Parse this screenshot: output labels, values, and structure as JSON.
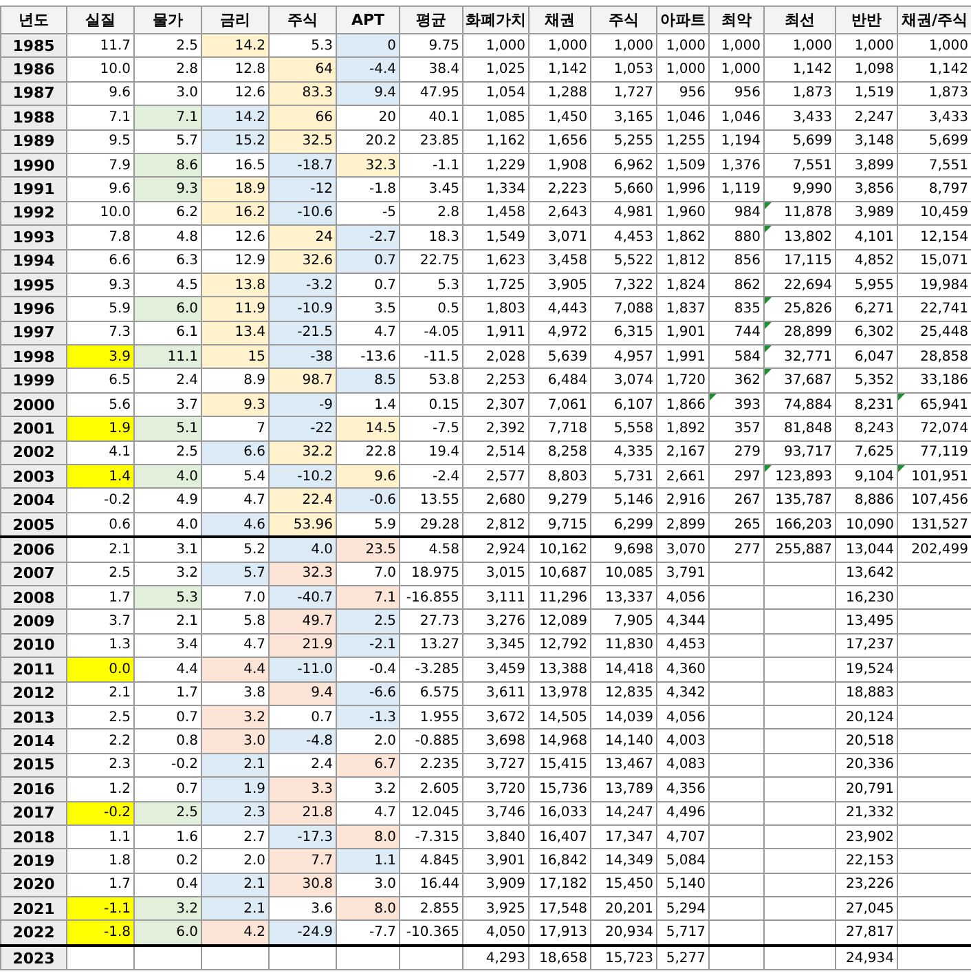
{
  "table": {
    "columns": [
      "년도",
      "실질",
      "물가",
      "금리",
      "주식",
      "APT",
      "평균",
      "화폐가치",
      "채권",
      "주식",
      "아파트",
      "최악",
      "최선",
      "반반",
      "채권/주식"
    ],
    "rows": [
      {
        "group_end": false,
        "cells": [
          "1985",
          "11.7",
          "2.5",
          {
            "text": "14.2",
            "color": "#fff2cc"
          },
          "5.3",
          {
            "text": "0",
            "color": "#ddebf7"
          },
          "9.75",
          "1,000",
          "1,000",
          "1,000",
          "1,000",
          "1,000",
          "1,000",
          "1,000",
          "1,000"
        ]
      },
      {
        "group_end": false,
        "cells": [
          "1986",
          "10.0",
          "2.8",
          "12.8",
          {
            "text": "64",
            "color": "#fff2cc"
          },
          {
            "text": "-4.4",
            "color": "#ddebf7"
          },
          "38.4",
          "1,025",
          "1,142",
          "1,053",
          "1,000",
          "1,000",
          "1,142",
          "1,098",
          "1,142"
        ]
      },
      {
        "group_end": false,
        "cells": [
          "1987",
          "9.6",
          "3.0",
          "12.6",
          {
            "text": "83.3",
            "color": "#fff2cc"
          },
          {
            "text": "9.4",
            "color": "#ddebf7"
          },
          "47.95",
          "1,054",
          "1,288",
          "1,727",
          "956",
          "956",
          "1,873",
          "1,519",
          "1,873"
        ]
      },
      {
        "group_end": false,
        "cells": [
          "1988",
          "7.1",
          {
            "text": "7.1",
            "color": "#e2efda"
          },
          {
            "text": "14.2",
            "color": "#ddebf7"
          },
          {
            "text": "66",
            "color": "#fff2cc"
          },
          "20",
          "40.1",
          "1,085",
          "1,450",
          "3,165",
          "1,046",
          "1,046",
          "3,433",
          "2,247",
          "3,433"
        ]
      },
      {
        "group_end": false,
        "cells": [
          "1989",
          "9.5",
          "5.7",
          {
            "text": "15.2",
            "color": "#ddebf7"
          },
          {
            "text": "32.5",
            "color": "#fff2cc"
          },
          "20.2",
          "23.85",
          "1,162",
          "1,656",
          "5,255",
          "1,255",
          "1,194",
          "5,699",
          "3,148",
          "5,699"
        ]
      },
      {
        "group_end": false,
        "cells": [
          "1990",
          "7.9",
          {
            "text": "8.6",
            "color": "#e2efda"
          },
          "16.5",
          {
            "text": "-18.7",
            "color": "#ddebf7"
          },
          {
            "text": "32.3",
            "color": "#fff2cc"
          },
          "-1.1",
          "1,229",
          "1,908",
          "6,962",
          "1,509",
          "1,376",
          "7,551",
          "3,899",
          "7,551"
        ]
      },
      {
        "group_end": false,
        "cells": [
          "1991",
          "9.6",
          {
            "text": "9.3",
            "color": "#e2efda"
          },
          {
            "text": "18.9",
            "color": "#fff2cc"
          },
          {
            "text": "-12",
            "color": "#ddebf7"
          },
          "-1.8",
          "3.45",
          "1,334",
          "2,223",
          "5,660",
          "1,996",
          "1,119",
          "9,990",
          "3,856",
          "8,797"
        ]
      },
      {
        "group_end": false,
        "cells": [
          "1992",
          "10.0",
          "6.2",
          {
            "text": "16.2",
            "color": "#fff2cc"
          },
          {
            "text": "-10.6",
            "color": "#ddebf7"
          },
          "-5",
          "2.8",
          "1,458",
          "2,643",
          "4,981",
          "1,960",
          "984",
          {
            "text": "11,878",
            "note": true
          },
          "3,989",
          "10,459"
        ]
      },
      {
        "group_end": false,
        "cells": [
          "1993",
          "7.8",
          "4.8",
          "12.6",
          {
            "text": "24",
            "color": "#fff2cc"
          },
          {
            "text": "-2.7",
            "color": "#ddebf7"
          },
          "18.3",
          "1,549",
          "3,071",
          "4,453",
          "1,862",
          "880",
          {
            "text": "13,802",
            "note": true
          },
          "4,101",
          "12,154"
        ]
      },
      {
        "group_end": false,
        "cells": [
          "1994",
          "6.6",
          "6.3",
          "12.9",
          {
            "text": "32.6",
            "color": "#fff2cc"
          },
          {
            "text": "0.7",
            "color": "#ddebf7"
          },
          "22.75",
          "1,623",
          "3,458",
          "5,522",
          "1,812",
          "856",
          "17,115",
          "4,852",
          "15,071"
        ]
      },
      {
        "group_end": false,
        "cells": [
          "1995",
          "9.3",
          "4.5",
          {
            "text": "13.8",
            "color": "#fff2cc"
          },
          {
            "text": "-3.2",
            "color": "#ddebf7"
          },
          "0.7",
          "5.3",
          "1,725",
          "3,905",
          "7,322",
          "1,824",
          "862",
          "22,694",
          "5,955",
          "19,984"
        ]
      },
      {
        "group_end": false,
        "cells": [
          "1996",
          "5.9",
          {
            "text": "6.0",
            "color": "#e2efda"
          },
          {
            "text": "11.9",
            "color": "#fff2cc"
          },
          {
            "text": "-10.9",
            "color": "#ddebf7"
          },
          "3.5",
          "0.5",
          "1,803",
          "4,443",
          "7,088",
          "1,837",
          "835",
          {
            "text": "25,826",
            "note": true
          },
          "6,271",
          "22,741"
        ]
      },
      {
        "group_end": false,
        "cells": [
          "1997",
          "7.3",
          "6.1",
          {
            "text": "13.4",
            "color": "#fff2cc"
          },
          {
            "text": "-21.5",
            "color": "#ddebf7"
          },
          "4.7",
          "-4.05",
          "1,911",
          "4,972",
          "6,315",
          "1,901",
          "744",
          {
            "text": "28,899",
            "note": true
          },
          "6,302",
          "25,448"
        ]
      },
      {
        "group_end": false,
        "cells": [
          "1998",
          {
            "text": "3.9",
            "color": "#ffff00"
          },
          {
            "text": "11.1",
            "color": "#e2efda"
          },
          {
            "text": "15",
            "color": "#fff2cc"
          },
          {
            "text": "-38",
            "color": "#ddebf7"
          },
          "-13.6",
          "-11.5",
          "2,028",
          "5,639",
          "4,957",
          "1,991",
          "584",
          {
            "text": "32,771",
            "note": true
          },
          "6,047",
          "28,858"
        ]
      },
      {
        "group_end": false,
        "cells": [
          "1999",
          "6.5",
          "2.4",
          "8.9",
          {
            "text": "98.7",
            "color": "#fff2cc"
          },
          {
            "text": "8.5",
            "color": "#ddebf7"
          },
          "53.8",
          "2,253",
          "6,484",
          "3,074",
          "1,720",
          "362",
          {
            "text": "37,687",
            "note": true
          },
          "5,352",
          "33,186"
        ]
      },
      {
        "group_end": false,
        "cells": [
          "2000",
          "5.6",
          "3.7",
          {
            "text": "9.3",
            "color": "#fff2cc"
          },
          {
            "text": "-9",
            "color": "#ddebf7"
          },
          "1.4",
          "0.15",
          "2,307",
          "7,061",
          "6,107",
          "1,866",
          {
            "text": "393",
            "note": true
          },
          "74,884",
          "8,231",
          {
            "text": "65,941",
            "note": true
          }
        ]
      },
      {
        "group_end": false,
        "cells": [
          "2001",
          {
            "text": "1.9",
            "color": "#ffff00"
          },
          {
            "text": "5.1",
            "color": "#e2efda"
          },
          "7",
          {
            "text": "-22",
            "color": "#ddebf7"
          },
          {
            "text": "14.5",
            "color": "#fff2cc"
          },
          "-7.5",
          "2,392",
          "7,718",
          "5,558",
          "1,892",
          "357",
          "81,848",
          "8,243",
          "72,074"
        ]
      },
      {
        "group_end": false,
        "cells": [
          "2002",
          "4.1",
          "2.5",
          {
            "text": "6.6",
            "color": "#ddebf7"
          },
          {
            "text": "32.2",
            "color": "#fff2cc"
          },
          "22.8",
          "19.4",
          "2,514",
          "8,258",
          "4,335",
          "2,167",
          "279",
          "93,717",
          "7,625",
          "77,119"
        ]
      },
      {
        "group_end": false,
        "cells": [
          "2003",
          {
            "text": "1.4",
            "color": "#ffff00"
          },
          {
            "text": "4.0",
            "color": "#e2efda"
          },
          "5.4",
          {
            "text": "-10.2",
            "color": "#ddebf7"
          },
          {
            "text": "9.6",
            "color": "#fff2cc"
          },
          "-2.4",
          "2,577",
          "8,803",
          "5,731",
          "2,661",
          "297",
          {
            "text": "123,893",
            "note": true
          },
          "9,104",
          {
            "text": "101,951",
            "note": true
          }
        ]
      },
      {
        "group_end": false,
        "cells": [
          "2004",
          "-0.2",
          "4.9",
          "4.7",
          {
            "text": "22.4",
            "color": "#fff2cc"
          },
          {
            "text": "-0.6",
            "color": "#ddebf7"
          },
          "13.55",
          "2,680",
          "9,279",
          "5,146",
          "2,916",
          "267",
          "135,787",
          "8,886",
          "107,456"
        ]
      },
      {
        "group_end": true,
        "cells": [
          "2005",
          "0.6",
          "4.0",
          {
            "text": "4.6",
            "color": "#ddebf7"
          },
          {
            "text": "53.96",
            "color": "#fff2cc"
          },
          "5.9",
          "29.28",
          "2,812",
          "9,715",
          "6,299",
          "2,899",
          "265",
          "166,203",
          "10,090",
          "131,527"
        ]
      },
      {
        "group_end": false,
        "cells": [
          "2006",
          "2.1",
          "3.1",
          "5.2",
          {
            "text": "4.0",
            "color": "#ddebf7"
          },
          {
            "text": "23.5",
            "color": "#fce4d6"
          },
          "4.58",
          "2,924",
          "10,162",
          "9,698",
          "3,070",
          "277",
          "255,887",
          "13,044",
          "202,499"
        ]
      },
      {
        "group_end": false,
        "cells": [
          "2007",
          "2.5",
          "3.2",
          {
            "text": "5.7",
            "color": "#ddebf7"
          },
          {
            "text": "32.3",
            "color": "#fce4d6"
          },
          "7.0",
          "18.975",
          "3,015",
          "10,687",
          "10,085",
          "3,791",
          null,
          null,
          "13,642",
          null
        ]
      },
      {
        "group_end": false,
        "cells": [
          "2008",
          "1.7",
          {
            "text": "5.3",
            "color": "#e2efda"
          },
          "7.0",
          {
            "text": "-40.7",
            "color": "#ddebf7"
          },
          {
            "text": "7.1",
            "color": "#fce4d6"
          },
          "-16.855",
          "3,111",
          "11,296",
          "13,337",
          "4,056",
          null,
          null,
          "16,230",
          null
        ]
      },
      {
        "group_end": false,
        "cells": [
          "2009",
          "3.7",
          "2.1",
          "5.8",
          {
            "text": "49.7",
            "color": "#fce4d6"
          },
          {
            "text": "2.5",
            "color": "#ddebf7"
          },
          "27.73",
          "3,276",
          "12,089",
          "7,905",
          "4,344",
          null,
          null,
          "13,495",
          null
        ]
      },
      {
        "group_end": false,
        "cells": [
          "2010",
          "1.3",
          "3.4",
          "4.7",
          {
            "text": "21.9",
            "color": "#fce4d6"
          },
          {
            "text": "-2.1",
            "color": "#ddebf7"
          },
          "13.27",
          "3,345",
          "12,792",
          "11,830",
          "4,453",
          null,
          null,
          "17,237",
          null
        ]
      },
      {
        "group_end": false,
        "cells": [
          "2011",
          {
            "text": "0.0",
            "color": "#ffff00"
          },
          "4.4",
          {
            "text": "4.4",
            "color": "#fce4d6"
          },
          {
            "text": "-11.0",
            "color": "#ddebf7"
          },
          "-0.4",
          "-3.285",
          "3,459",
          "13,388",
          "14,418",
          "4,360",
          null,
          null,
          "19,524",
          null
        ]
      },
      {
        "group_end": false,
        "cells": [
          "2012",
          "2.1",
          "1.7",
          "3.8",
          {
            "text": "9.4",
            "color": "#fce4d6"
          },
          {
            "text": "-6.6",
            "color": "#ddebf7"
          },
          "6.575",
          "3,611",
          "13,978",
          "12,835",
          "4,342",
          null,
          null,
          "18,883",
          null
        ]
      },
      {
        "group_end": false,
        "cells": [
          "2013",
          "2.5",
          "0.7",
          {
            "text": "3.2",
            "color": "#fce4d6"
          },
          "0.7",
          {
            "text": "-1.3",
            "color": "#ddebf7"
          },
          "1.955",
          "3,672",
          "14,505",
          "14,039",
          "4,056",
          null,
          null,
          "20,124",
          null
        ]
      },
      {
        "group_end": false,
        "cells": [
          "2014",
          "2.2",
          "0.8",
          {
            "text": "3.0",
            "color": "#fce4d6"
          },
          {
            "text": "-4.8",
            "color": "#ddebf7"
          },
          "2.0",
          "-0.885",
          "3,698",
          "14,968",
          "14,140",
          "4,003",
          null,
          null,
          "20,518",
          null
        ]
      },
      {
        "group_end": false,
        "cells": [
          "2015",
          "2.3",
          "-0.2",
          {
            "text": "2.1",
            "color": "#ddebf7"
          },
          "2.4",
          {
            "text": "6.7",
            "color": "#fce4d6"
          },
          "2.235",
          "3,727",
          "15,415",
          "13,467",
          "4,083",
          null,
          null,
          "20,336",
          null
        ]
      },
      {
        "group_end": false,
        "cells": [
          "2016",
          "1.2",
          "0.7",
          {
            "text": "1.9",
            "color": "#ddebf7"
          },
          {
            "text": "3.3",
            "color": "#fce4d6"
          },
          "3.2",
          "2.605",
          "3,720",
          "15,736",
          "13,789",
          "4,356",
          null,
          null,
          "20,791",
          null
        ]
      },
      {
        "group_end": false,
        "cells": [
          "2017",
          {
            "text": "-0.2",
            "color": "#ffff00"
          },
          {
            "text": "2.5",
            "color": "#e2efda"
          },
          {
            "text": "2.3",
            "color": "#ddebf7"
          },
          {
            "text": "21.8",
            "color": "#fce4d6"
          },
          "4.7",
          "12.045",
          "3,746",
          "16,033",
          "14,247",
          "4,496",
          null,
          null,
          "21,332",
          null
        ]
      },
      {
        "group_end": false,
        "cells": [
          "2018",
          "1.1",
          "1.6",
          "2.7",
          {
            "text": "-17.3",
            "color": "#ddebf7"
          },
          {
            "text": "8.0",
            "color": "#fce4d6"
          },
          "-7.315",
          "3,840",
          "16,407",
          "17,347",
          "4,707",
          null,
          null,
          "23,902",
          null
        ]
      },
      {
        "group_end": false,
        "cells": [
          "2019",
          "1.8",
          "0.2",
          "2.0",
          {
            "text": "7.7",
            "color": "#fce4d6"
          },
          {
            "text": "1.1",
            "color": "#ddebf7"
          },
          "4.845",
          "3,901",
          "16,842",
          "14,349",
          "5,084",
          null,
          null,
          "22,153",
          null
        ]
      },
      {
        "group_end": false,
        "cells": [
          "2020",
          "1.7",
          "0.4",
          {
            "text": "2.1",
            "color": "#ddebf7"
          },
          {
            "text": "30.8",
            "color": "#fce4d6"
          },
          "3.0",
          "16.44",
          "3,909",
          "17,182",
          "15,450",
          "5,140",
          null,
          null,
          "23,226",
          null
        ]
      },
      {
        "group_end": false,
        "cells": [
          "2021",
          {
            "text": "-1.1",
            "color": "#ffff00"
          },
          {
            "text": "3.2",
            "color": "#e2efda"
          },
          {
            "text": "2.1",
            "color": "#ddebf7"
          },
          "3.6",
          {
            "text": "8.0",
            "color": "#fce4d6"
          },
          "2.855",
          "3,925",
          "17,548",
          "20,201",
          "5,294",
          null,
          null,
          "27,045",
          null
        ]
      },
      {
        "group_end": true,
        "cells": [
          "2022",
          {
            "text": "-1.8",
            "color": "#ffff00"
          },
          {
            "text": "6.0",
            "color": "#e2efda"
          },
          {
            "text": "4.2",
            "color": "#fce4d6"
          },
          {
            "text": "-24.9",
            "color": "#ddebf7"
          },
          "-7.7",
          "-10.365",
          "4,050",
          "17,913",
          "20,934",
          "5,717",
          null,
          null,
          "27,817",
          null
        ]
      },
      {
        "group_end": false,
        "cells": [
          "2023",
          null,
          null,
          null,
          null,
          null,
          null,
          "4,293",
          "18,658",
          "15,723",
          "5,277",
          null,
          null,
          "24,934",
          null
        ]
      }
    ]
  }
}
